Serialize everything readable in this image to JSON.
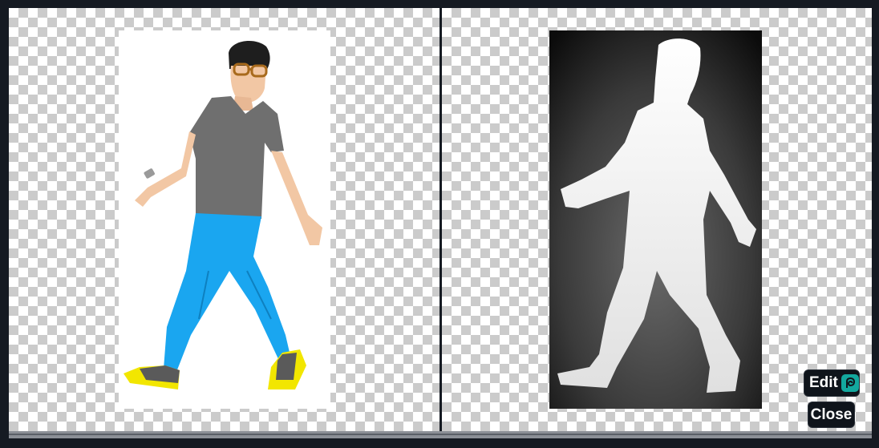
{
  "viewer": {
    "left_panel": {
      "image": "rgb-image"
    },
    "right_panel": {
      "image": "depth-map-image"
    }
  },
  "toolbar": {
    "edit_label": "Edit",
    "edit_icon": "photopea-icon",
    "close_label": "Close"
  },
  "colors": {
    "background": "#151a22",
    "checker_light": "#ffffff",
    "checker_dark": "#cbcbcb",
    "shirt": "#6f6f6f",
    "jeans": "#1aa6f0",
    "shoes": "#f2e600",
    "icon_teal": "#13a89e"
  }
}
